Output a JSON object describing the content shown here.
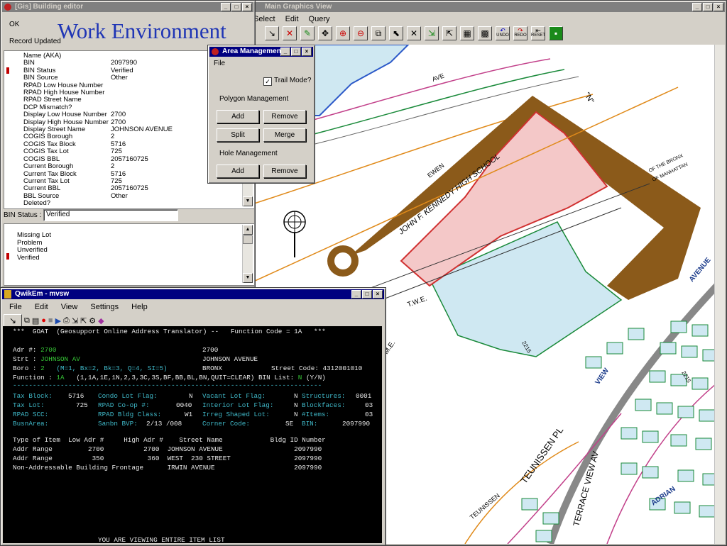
{
  "heading": "Work Environment",
  "colors": {
    "heading": "#1f35b5",
    "title_active": "#000080",
    "title_inactive": "#808080",
    "terminal_bg": "#000000",
    "terminal_cyan": "#3fb8c8",
    "terminal_green": "#36c636",
    "parcel_building_fill": "#f4c8c8",
    "parcel_outline": "#d03030",
    "road_brown": "#8b5a1a",
    "water_blue": "#bfe3ef"
  },
  "building_editor": {
    "title": "[Gis] Building editor",
    "status_ok": "OK",
    "status_record": "Record Updated",
    "properties": [
      {
        "key": "Name (AKA)",
        "value": ""
      },
      {
        "key": "BIN",
        "value": "2097990"
      },
      {
        "key": "BIN Status",
        "value": "Verified"
      },
      {
        "key": "BIN Source",
        "value": "Other"
      },
      {
        "key": "RPAD Low House Number",
        "value": ""
      },
      {
        "key": "RPAD High House Number",
        "value": ""
      },
      {
        "key": "RPAD Street Name",
        "value": ""
      },
      {
        "key": "DCP Mismatch?",
        "value": ""
      },
      {
        "key": "Display Low House Number",
        "value": "2700"
      },
      {
        "key": "Display High House Number",
        "value": "2700"
      },
      {
        "key": "Display Street Name",
        "value": "JOHNSON AVENUE"
      },
      {
        "key": "COGIS Borough",
        "value": "2"
      },
      {
        "key": "COGIS Tax Block",
        "value": "5716"
      },
      {
        "key": "COGIS Tax Lot",
        "value": "725"
      },
      {
        "key": "COGIS BBL",
        "value": "2057160725"
      },
      {
        "key": "Current Borough",
        "value": "2"
      },
      {
        "key": "Current Tax Block",
        "value": "5716"
      },
      {
        "key": "Current Tax Lot",
        "value": "725"
      },
      {
        "key": "Current BBL",
        "value": "2057160725"
      },
      {
        "key": "BBL Source",
        "value": "Other"
      },
      {
        "key": "Deleted?",
        "value": ""
      }
    ],
    "bin_status_label": "BIN Status :",
    "bin_status_value": "Verified",
    "status_options": [
      "Missing Lot",
      "Problem",
      "Unverified",
      "Verified"
    ]
  },
  "area_management": {
    "title": "Area Management",
    "menu_file": "File",
    "trail_mode_label": "Trail Mode?",
    "trail_mode_checked": true,
    "polygon_section": "Polygon Management",
    "add": "Add",
    "remove": "Remove",
    "split": "Split",
    "merge": "Merge",
    "hole_section": "Hole Management",
    "hole_add": "Add",
    "hole_remove": "Remove"
  },
  "main_graphics": {
    "title": "Main Graphics View",
    "menu": [
      "Select",
      "Edit",
      "Query"
    ],
    "toolbar": [
      "select-tool",
      "delete-tool",
      "draw-tool",
      "pan-tool",
      "zoom-in",
      "zoom-out",
      "copy-tool",
      "pointer-tool",
      "close-tool",
      "import-tool",
      "export-tool",
      "layer-tool",
      "layer2-tool",
      "undo",
      "redo",
      "reset",
      "save-tool"
    ],
    "undo_label": "UNDO",
    "redo_label": "REDO",
    "reset_label": "RESET",
    "map_labels": {
      "school": "JOHN F. KENNEDY HIGH SCHOOL",
      "ewen": "EWEN",
      "avenue": "AVENUE",
      "view": "VIEW",
      "terrace": "TERRACE VIEW AV",
      "teunissen": "TEUNISSEN",
      "teunissen_pl": "TEUNISSEN PL",
      "adrian": "ADRIAN",
      "n": "\"N\"",
      "num_2215": "2215",
      "ave": "AVE",
      "bronx": "OF THE BRONX",
      "manhattan": "OF MANHATTAN",
      "me": "M.E.",
      "twe": "T.W.E."
    }
  },
  "qwikem": {
    "title": "QwikEm - mvsw",
    "menu": [
      "File",
      "Edit",
      "View",
      "Settings",
      "Help"
    ],
    "lines": {
      "header": "***  GOAT  (Geosupport Online Address Translator) --   Function Code = 1A   ***",
      "adr_label": "Adr #:",
      "adr_value": "2700",
      "adr_right": "2700",
      "strt_label": "Strt :",
      "strt_value": "JOHNSON AV",
      "strt_right": "JOHNSON AVENUE",
      "boro_label": "Boro :",
      "boro_value": "2",
      "boro_hint": "(M=1, Bx=2, Bk=3, Q=4, SI=5)",
      "boro_name": "BRONX",
      "street_code": "Street Code: 4312001010",
      "func_label": "Function :",
      "func_value": "1A",
      "func_opts": "(1,1A,1E,1N,2,3,3C,3S,BF,BB,BL,BN,QUIT=CLEAR) BIN List:",
      "bin_list": "N",
      "yn": "(Y/N)",
      "sep": "------------------------------------------------------------------------------",
      "tax_block_label": "Tax Block:",
      "tax_block": "5716",
      "condo_label": "Condo Lot Flag:",
      "condo": "N",
      "vacant_label": "Vacant Lot Flag:",
      "vacant": "N",
      "structures_label": "Structures:",
      "structures": "0001",
      "tax_lot_label": "Tax Lot:",
      "tax_lot": "725",
      "coop_label": "RPAD Co-op #:",
      "coop": "0040",
      "interior_label": "Interior Lot Flag:",
      "interior": "N",
      "blockfaces_label": "Blockfaces:",
      "blockfaces": "03",
      "rpad_scc_label": "RPAD SCC:",
      "bldg_class_label": "RPAD Bldg Class:",
      "bldg_class": "W1",
      "irreg_label": "Irreg Shaped Lot:",
      "irreg": "N",
      "items_label": "#Items:",
      "items": "03",
      "busn_label": "BusnArea:",
      "sanbn_label": "Sanbn BVP:",
      "sanbn": "2/13 /008",
      "corner_label": "Corner Code:",
      "corner": "SE",
      "bin_label": "BIN:",
      "bin": "2097990",
      "table_header": "Type of Item  Low Adr #     High Adr #    Street Name            Bldg ID Number",
      "row1": "Addr Range         2700          2700  JOHNSON AVENUE                  2097990",
      "row2": "Addr Range          350           360  WEST  230 STREET                2097990",
      "row3": "Non-Addressable Building Frontage      IRWIN AVENUE                    2097990",
      "footer": "YOU ARE VIEWING ENTIRE ITEM LIST"
    }
  }
}
